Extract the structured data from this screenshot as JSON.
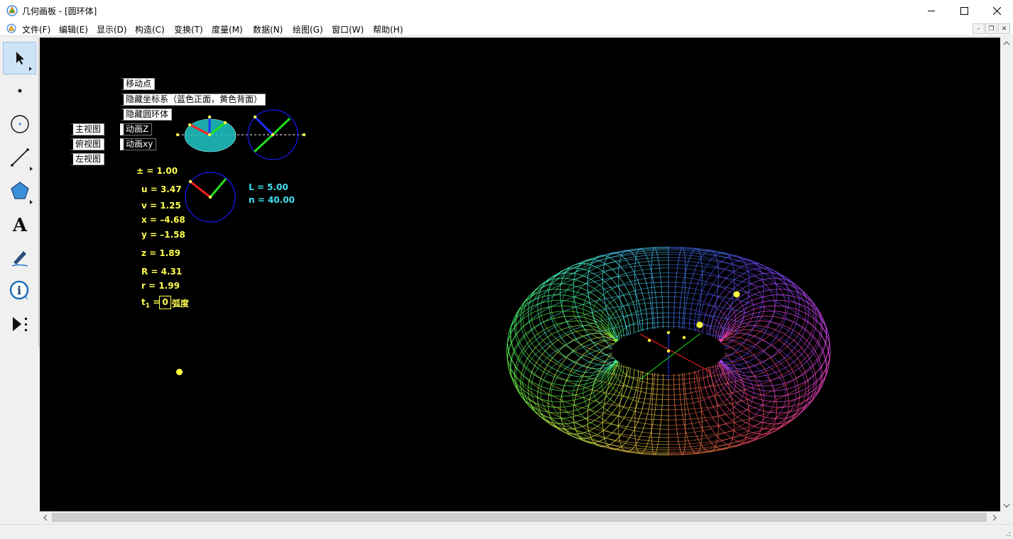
{
  "window": {
    "title": "几何画板 - [圆环体]",
    "controls": [
      "minimize",
      "maximize",
      "close"
    ]
  },
  "menu": {
    "items": [
      "文件(F)",
      "编辑(E)",
      "显示(D)",
      "构造(C)",
      "变换(T)",
      "度量(M)",
      "数据(N)",
      "绘图(G)",
      "窗口(W)",
      "帮助(H)"
    ]
  },
  "toolbox": {
    "tools": [
      "selection-arrow-icon",
      "point-icon",
      "compass-icon",
      "straightedge-icon",
      "polygon-icon",
      "text-icon",
      "marker-icon",
      "information-icon",
      "custom-tool-icon"
    ]
  },
  "sketch": {
    "buttons": {
      "move_point": "移动点",
      "hide_axes": "隐藏坐标系（蓝色正面，黄色背面）",
      "hide_torus": "隐藏圆环体",
      "animate_z": "动画Z",
      "animate_xy": "动画xy",
      "front_view": "主视图",
      "top_view": "俯视图",
      "left_view": "左视图"
    },
    "measurements": {
      "pm": "± = 1.00",
      "u": "u = 3.47",
      "v": "v = 1.25",
      "x": "x = –4.68",
      "y": "y = –1.58",
      "z": "z = 1.89",
      "R": "R = 4.31",
      "r": "r = 1.99",
      "L": "L = 5.00",
      "n": "n = 40.00"
    },
    "parameter": {
      "label": "t",
      "subscript": "1",
      "equals": "=",
      "value": "0",
      "unit": "弧度"
    }
  },
  "colors": {
    "canvas": "#000000",
    "measure_text": "#ffff50",
    "cyan_text": "#40e0f0",
    "point": "#ffff3c",
    "axis_x": "#ff2020",
    "axis_y": "#20e020",
    "axis_z": "#2030ff"
  }
}
